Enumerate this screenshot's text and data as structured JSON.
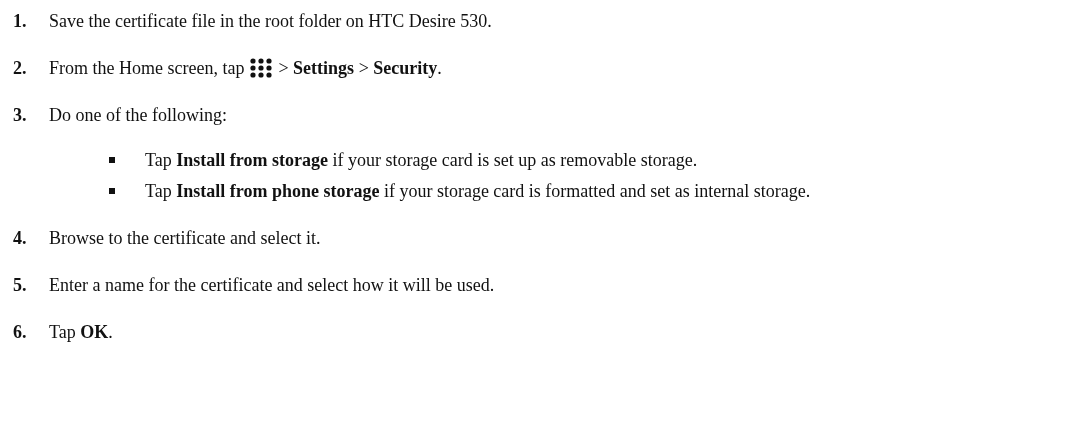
{
  "steps": [
    {
      "number": "1.",
      "parts": [
        {
          "kind": "text",
          "text": "Save the certificate file in the root folder on HTC Desire 530."
        }
      ]
    },
    {
      "number": "2.",
      "parts": [
        {
          "kind": "text",
          "text": "From the Home screen, tap"
        },
        {
          "kind": "apps_icon"
        },
        {
          "kind": "text",
          "text": "> **Settings** > **Security**."
        }
      ]
    },
    {
      "number": "3.",
      "parts": [
        {
          "kind": "text",
          "text": "Do one of the following:"
        }
      ],
      "children": [
        {
          "parts": [
            {
              "kind": "text",
              "text": "Tap **Install from storage** if your storage card is set up as removable storage."
            }
          ]
        },
        {
          "parts": [
            {
              "kind": "text",
              "text": "Tap **Install from phone storage** if your storage card is formatted and set as internal storage."
            }
          ]
        }
      ]
    },
    {
      "number": "4.",
      "parts": [
        {
          "kind": "text",
          "text": "Browse to the certificate and select it."
        }
      ]
    },
    {
      "number": "5.",
      "parts": [
        {
          "kind": "text",
          "text": "Enter a name for the certificate and select how it will be used."
        }
      ]
    },
    {
      "number": "6.",
      "parts": [
        {
          "kind": "text",
          "text": "Tap **OK**."
        }
      ]
    }
  ]
}
